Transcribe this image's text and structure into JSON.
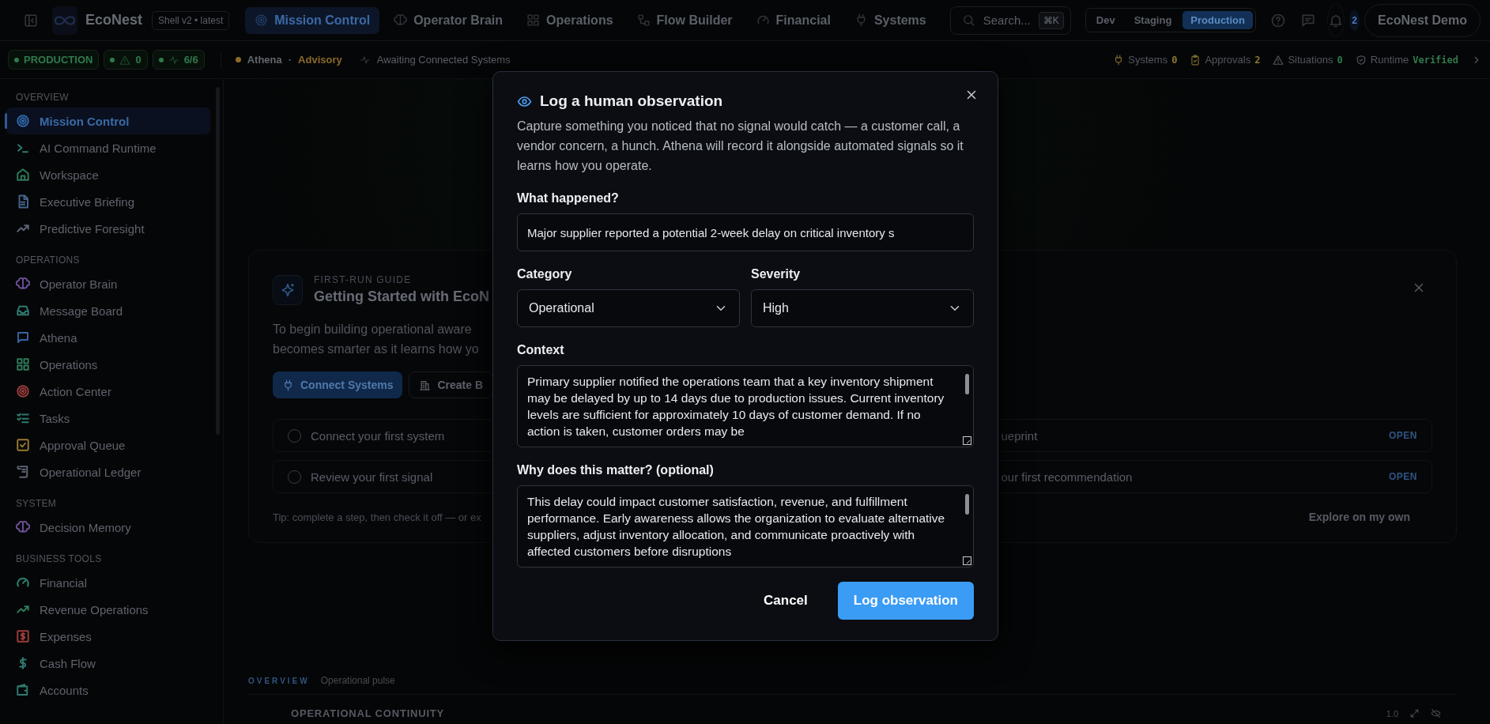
{
  "topbar": {
    "brand": "EcoNest",
    "version": "Shell v2 • latest",
    "nav": [
      {
        "label": "Mission Control",
        "selected": true
      },
      {
        "label": "Operator Brain",
        "selected": false
      },
      {
        "label": "Operations",
        "selected": false
      },
      {
        "label": "Flow Builder",
        "selected": false
      },
      {
        "label": "Financial",
        "selected": false
      },
      {
        "label": "Systems",
        "selected": false
      }
    ],
    "search": {
      "placeholder": "Search...",
      "shortcut": "⌘K"
    },
    "environments": [
      {
        "label": "Dev",
        "selected": false
      },
      {
        "label": "Staging",
        "selected": false
      },
      {
        "label": "Production",
        "selected": true
      }
    ],
    "notifications": "2",
    "account": "EcoNest Demo"
  },
  "status_bar": {
    "environment": "PRODUCTION",
    "alerts": "0",
    "health": "6/6",
    "assistant": "Athena",
    "separator": "·",
    "mode": "Advisory",
    "message": "Awaiting Connected Systems",
    "counters": [
      {
        "label": "Systems",
        "value": "0",
        "color": "#8a7a30"
      },
      {
        "label": "Approvals",
        "value": "2",
        "color": "#8a7a30"
      },
      {
        "label": "Situations",
        "value": "0",
        "color": "#2f7a4c"
      },
      {
        "label": "Runtime",
        "value": "Verified",
        "color": "#2f7a4c"
      }
    ]
  },
  "sidebar": {
    "sections": [
      {
        "title": "OVERVIEW",
        "items": [
          {
            "label": "Mission Control",
            "selected": true,
            "color": "#2f67a8"
          },
          {
            "label": "AI Command Runtime",
            "selected": false,
            "color": "#2e7a70"
          },
          {
            "label": "Workspace",
            "selected": false,
            "color": "#2e7a5c"
          },
          {
            "label": "Executive Briefing",
            "selected": false,
            "color": "#44648a"
          },
          {
            "label": "Predictive Foresight",
            "selected": false,
            "color": "#5c6370"
          }
        ]
      },
      {
        "title": "OPERATIONS",
        "items": [
          {
            "label": "Operator Brain",
            "selected": false,
            "color": "#6a4e94"
          },
          {
            "label": "Message Board",
            "selected": false,
            "color": "#2e7a70"
          },
          {
            "label": "Athena",
            "selected": false,
            "color": "#3563a0"
          },
          {
            "label": "Operations",
            "selected": false,
            "color": "#2e7a5c"
          },
          {
            "label": "Action Center",
            "selected": false,
            "color": "#9a3c3c"
          },
          {
            "label": "Tasks",
            "selected": false,
            "color": "#2e7a70"
          },
          {
            "label": "Approval Queue",
            "selected": false,
            "color": "#9a7a30"
          },
          {
            "label": "Operational Ledger",
            "selected": false,
            "color": "#5c6370"
          }
        ]
      },
      {
        "title": "SYSTEM",
        "items": [
          {
            "label": "Decision Memory",
            "selected": false,
            "color": "#6a4e94"
          }
        ]
      },
      {
        "title": "BUSINESS TOOLS",
        "items": [
          {
            "label": "Financial",
            "selected": false,
            "color": "#2e7a70"
          },
          {
            "label": "Revenue Operations",
            "selected": false,
            "color": "#2e7a5c"
          },
          {
            "label": "Expenses",
            "selected": false,
            "color": "#9a3c3c"
          },
          {
            "label": "Cash Flow",
            "selected": false,
            "color": "#2e7a70"
          },
          {
            "label": "Accounts",
            "selected": false,
            "color": "#2e7a70"
          }
        ]
      }
    ]
  },
  "guide": {
    "eyebrow": "FIRST-RUN GUIDE",
    "title": "Getting Started with EcoN",
    "description": [
      "To begin building operational aware",
      "becomes smarter as it learns how yo"
    ],
    "actions": [
      {
        "label": "Connect Systems",
        "kind": "primary"
      },
      {
        "label": "Create B",
        "kind": "secondary"
      }
    ],
    "steps": [
      {
        "label": "Connect your first system",
        "checked": false
      },
      {
        "label": "Review your first signal",
        "checked": false
      }
    ],
    "steps_right": [
      {
        "label": "ueprint",
        "action": "OPEN"
      },
      {
        "label": "our first recommendation",
        "action": "OPEN"
      }
    ],
    "tip": "Tip: complete a step, then check it off — or ex",
    "dismiss": "Explore on my own"
  },
  "overview": {
    "title": "OVERVIEW",
    "subtitle": "Operational pulse",
    "section": "OPERATIONAL CONTINUITY",
    "value": "1.0"
  },
  "dialog": {
    "title": "Log a human observation",
    "description": "Capture something you noticed that no signal would catch — a customer call, a vendor concern, a hunch. Athena will record it alongside automated signals so it learns how you operate.",
    "fields": [
      {
        "kind": "text",
        "label": "What happened?",
        "value": "Major supplier reported a potential 2-week delay on critical inventory s"
      },
      {
        "kind": "select",
        "label": "Category",
        "value": "Operational"
      },
      {
        "kind": "select",
        "label": "Severity",
        "value": "High"
      },
      {
        "kind": "textarea",
        "label": "Context",
        "value": "Primary supplier notified the operations team that a key inventory shipment may be delayed by up to 14 days due to production issues. Current inventory levels are sufficient for approximately 10 days of customer demand. If no action is taken, customer orders may be"
      },
      {
        "kind": "textarea",
        "label": "Why does this matter? (optional)",
        "value": "This delay could impact customer satisfaction, revenue, and fulfillment performance. Early awareness allows the organization to evaluate alternative suppliers, adjust inventory allocation, and communicate proactively with affected customers before disruptions"
      }
    ],
    "buttons": [
      {
        "label": "Cancel",
        "kind": "secondary"
      },
      {
        "label": "Log observation",
        "kind": "primary"
      }
    ]
  }
}
